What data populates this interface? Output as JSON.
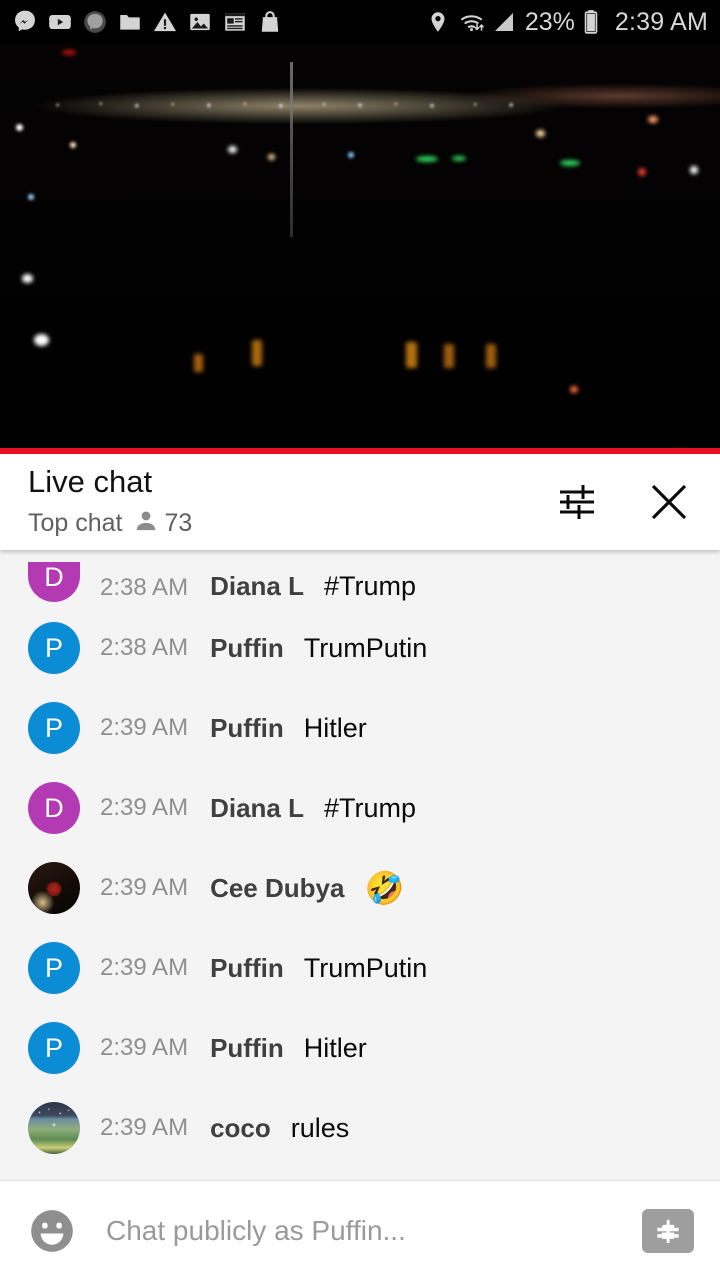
{
  "status_bar": {
    "left_icons": [
      {
        "name": "messenger-m-icon"
      },
      {
        "name": "youtube-icon"
      },
      {
        "name": "messenger-m-dim-icon"
      },
      {
        "name": "folder-icon"
      },
      {
        "name": "warning-triangle-icon"
      },
      {
        "name": "image-icon"
      },
      {
        "name": "news-article-icon"
      },
      {
        "name": "shopping-bag-icon"
      }
    ],
    "location_icon": "location-pin-icon",
    "wifi_icon": "wifi-data-icon",
    "signal_icon": "cellular-signal-icon",
    "battery_percent": "23%",
    "battery_icon": "battery-icon",
    "time": "2:39 AM"
  },
  "video": {
    "name": "live-video-player",
    "progress_percent": 100,
    "progress_color": "#e81123"
  },
  "chat": {
    "title": "Live chat",
    "subtitle": "Top chat",
    "viewer_icon": "person-icon",
    "viewer_count": "73",
    "settings_icon": "tune-sliders-icon",
    "close_icon": "close-icon",
    "messages": [
      {
        "time": "2:38 AM",
        "user": "Diana L",
        "text": "#Trump",
        "avatar_type": "letter",
        "avatar_letter": "D",
        "avatar_color": "#b43ab4",
        "clipped": true
      },
      {
        "time": "2:38 AM",
        "user": "Puffin",
        "text": "TrumPutin",
        "avatar_type": "letter",
        "avatar_letter": "P",
        "avatar_color": "#0b8dd6",
        "clipped": false
      },
      {
        "time": "2:39 AM",
        "user": "Puffin",
        "text": "Hitler",
        "avatar_type": "letter",
        "avatar_letter": "P",
        "avatar_color": "#0b8dd6",
        "clipped": false
      },
      {
        "time": "2:39 AM",
        "user": "Diana L",
        "text": "#Trump",
        "avatar_type": "letter",
        "avatar_letter": "D",
        "avatar_color": "#b43ab4",
        "clipped": false
      },
      {
        "time": "2:39 AM",
        "user": "Cee Dubya",
        "text": "🤣",
        "avatar_type": "photo-cee",
        "avatar_letter": "",
        "avatar_color": "#2a1a12",
        "clipped": false
      },
      {
        "time": "2:39 AM",
        "user": "Puffin",
        "text": "TrumPutin",
        "avatar_type": "letter",
        "avatar_letter": "P",
        "avatar_color": "#0b8dd6",
        "clipped": false
      },
      {
        "time": "2:39 AM",
        "user": "Puffin",
        "text": "Hitler",
        "avatar_type": "letter",
        "avatar_letter": "P",
        "avatar_color": "#0b8dd6",
        "clipped": false
      },
      {
        "time": "2:39 AM",
        "user": "coco",
        "text": "rules",
        "avatar_type": "photo-coco",
        "avatar_letter": "",
        "avatar_color": "#6d8ea0",
        "clipped": false
      }
    ]
  },
  "input_bar": {
    "emoji_icon": "emoji-smiley-icon",
    "placeholder": "Chat publicly as Puffin...",
    "value": "",
    "superchat_icon": "dollar-sign-icon"
  }
}
